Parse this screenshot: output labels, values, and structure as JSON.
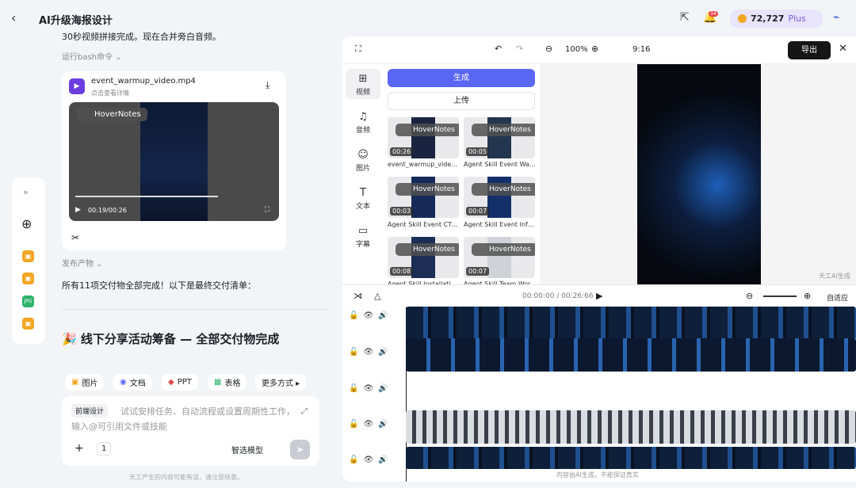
{
  "header": {
    "back": "‹",
    "title": "AI升级海报设计",
    "credits": "72,727",
    "plan": "Plus",
    "notif": "34"
  },
  "chat": {
    "line1": "30秒视频拼接完成。现在合并旁白音频。",
    "bash": "运行bash命令 ⌄",
    "file": "event_warmup_video.mp4",
    "detail": "点击查看详情",
    "hover": "HoverNotes",
    "time": "00:19/00:26",
    "publish": "发布产物 ⌄",
    "done": "所有11项交付物全部完成！以下是最终交付清单：",
    "heading": "🎉 线下分享活动筹备 — 全部交付物完成"
  },
  "chips": [
    "图片",
    "文档",
    "PPT",
    "表格",
    "更多方式 ▸"
  ],
  "composer": {
    "tag": "前端设计",
    "placeholder": "试试安排任务、自动流程或设置周期性工作，输入@可引用文件或技能",
    "count": "1",
    "model": "智选模型",
    "disclaimer": "天工产生的内容可能有误，请注意核查。"
  },
  "editor": {
    "zoom": "100%",
    "ratio": "9:16",
    "export": "导出",
    "generate": "生成",
    "upload": "上传",
    "rail": [
      "视频",
      "音频",
      "图片",
      "文本",
      "字幕"
    ],
    "assets": [
      {
        "d": "00:26",
        "n": "event_warmup_video..."
      },
      {
        "d": "00:05",
        "n": "Agent Skill Event War..."
      },
      {
        "d": "00:03",
        "n": "Agent Skill Event CTA...."
      },
      {
        "d": "00:07",
        "n": "Agent Skill Event Info...."
      },
      {
        "d": "00:08",
        "n": "Agent Skill Installation..."
      },
      {
        "d": "00:07",
        "n": "Agent Skill Team Wor..."
      }
    ],
    "watermark": "天工AI生成",
    "timecode": "00:00:00 / 00:26:66",
    "fit": "自适应",
    "footer": "内容由AI生成，不能保证真实"
  }
}
